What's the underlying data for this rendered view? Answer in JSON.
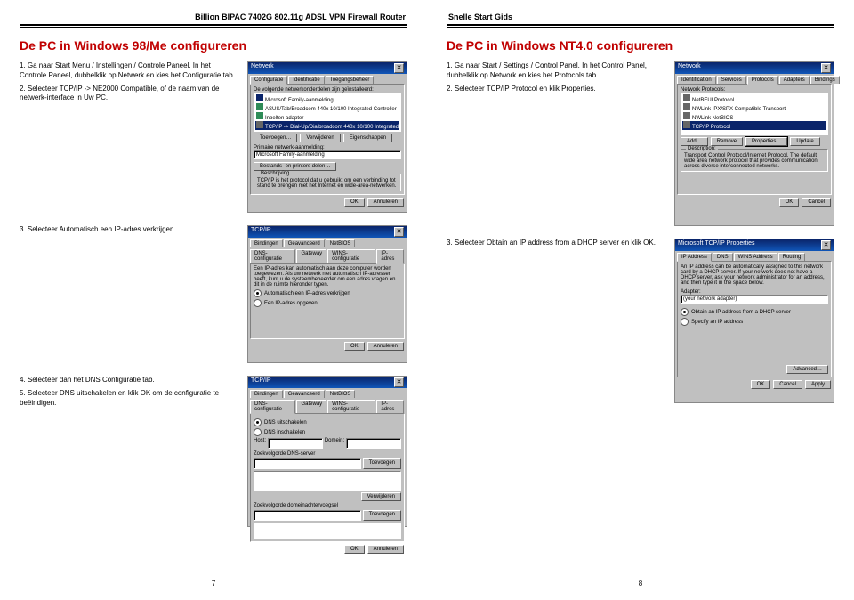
{
  "header": {
    "left_title": "Billion BIPAC 7402G 802.11g ADSL VPN Firewall Router",
    "right_title": "Snelle Start Gids"
  },
  "left_page": {
    "section_title": "De PC in Windows 98/Me configureren",
    "step1": "1. Ga naar Start Menu / Instellingen / Controle Paneel. In het Controle Paneel, dubbelklik op Netwerk en kies het Configuratie tab.",
    "step2": "2. Selecteer TCP/IP -> NE2000 Compatible, of de naam van de netwerk-interface in Uw PC.",
    "step3": "3. Selecteer Automatisch een IP-adres verkrijgen.",
    "step4": "4. Selecteer dan het DNS Configuratie tab.",
    "step5": "5. Selecteer DNS uitschakelen en klik OK om de configuratie te beëindigen.",
    "pagenum": "7",
    "dlg1": {
      "title": "Netwerk",
      "tabs": [
        "Configuratie",
        "Identificatie",
        "Toegangsbeheer"
      ],
      "label1": "De volgende netwerkonderdelen zijn geïnstalleerd:",
      "items": [
        "Microsoft Family-aanmelding",
        "ASUS/Tab/Broadcom 440x 10/100 Integrated Controller",
        "Inbelten adapter",
        "TCP/IP -> Dial-Up/Dialbroadcom 440x 10/100 Integrated"
      ],
      "btn_add": "Toevoegen…",
      "btn_rem": "Verwijderen",
      "btn_prop": "Eigenschappen",
      "label2": "Primaire netwerk-aanmelding:",
      "sel": "Microsoft Family-aanmelding",
      "btn_share": "Bestands- en printers delen…",
      "desc_title": "Beschrijving",
      "desc": "TCP/IP is het protocol dat u gebruikt om een verbinding tot stand te brengen met het Internet en wide-area-netwerken.",
      "ok": "OK",
      "cancel": "Annuleren"
    },
    "dlg2": {
      "title": "TCP/IP",
      "tabs": [
        "Bindingen",
        "Geavanceerd",
        "NetBIOS"
      ],
      "tabs2": [
        "DNS-configuratie",
        "Gateway",
        "WINS-configuratie",
        "IP-adres"
      ],
      "desc": "Een IP-adres kan automatisch aan deze computer worden toegewezen. Als uw netwerk niet automatisch IP-adressen heeft, kunt u de systeembeheerder om een adres vragen en dit in de ruimte hieronder typen.",
      "r1": "Automatisch een IP-adres verkrijgen",
      "r2": "Een IP-adres opgeven",
      "ok": "OK",
      "cancel": "Annuleren"
    },
    "dlg3": {
      "title": "TCP/IP",
      "tabs": [
        "Bindingen",
        "Geavanceerd",
        "NetBIOS"
      ],
      "tabs2": [
        "DNS-configuratie",
        "Gateway",
        "WINS-configuratie",
        "IP-adres"
      ],
      "r1": "DNS uitschakelen",
      "r2": "DNS inschakelen",
      "l_host": "Host:",
      "l_dom": "Domein:",
      "l_ord": "Zoekvolgorde DNS-server",
      "l_suf": "Zoekvolgorde domeinachtervoegsel",
      "add": "Toevoegen",
      "rem": "Verwijderen",
      "ok": "OK",
      "cancel": "Annuleren"
    }
  },
  "right_page": {
    "section_title": "De PC in Windows NT4.0 configureren",
    "step1": "1. Ga naar Start / Settings / Control Panel. In het Control Panel, dubbelklik op Network en kies het Protocols tab.",
    "step2": "2. Selecteer TCP/IP Protocol en klik Properties.",
    "step3": "3. Selecteer Obtain an IP address from a DHCP server en klik OK.",
    "pagenum": "8",
    "dlg1": {
      "title": "Network",
      "tabs": [
        "Identification",
        "Services",
        "Protocols",
        "Adapters",
        "Bindings"
      ],
      "label": "Network Protocols:",
      "items": [
        "NetBEUI Protocol",
        "NWLink IPX/SPX Compatible Transport",
        "NWLink NetBIOS",
        "TCP/IP Protocol"
      ],
      "add": "Add…",
      "rem": "Remove",
      "prop": "Properties…",
      "upd": "Update",
      "desc_title": "Description:",
      "desc": "Transport Control Protocol/Internet Protocol. The default wide area network protocol that provides communication across diverse interconnected networks.",
      "ok": "OK",
      "cancel": "Cancel"
    },
    "dlg2": {
      "title": "Microsoft TCP/IP Properties",
      "tabs": [
        "IP Address",
        "DNS",
        "WINS Address",
        "Routing"
      ],
      "desc": "An IP address can be automatically assigned to this network card by a DHCP server. If your network does not have a DHCP server, ask your network administrator for an address, and then type it in the space below.",
      "l_adapter": "Adapter:",
      "adapter": "(your network adapter)",
      "r1": "Obtain an IP address from a DHCP server",
      "r2": "Specify an IP address",
      "adv": "Advanced…",
      "ok": "OK",
      "cancel": "Cancel",
      "apply": "Apply"
    }
  }
}
